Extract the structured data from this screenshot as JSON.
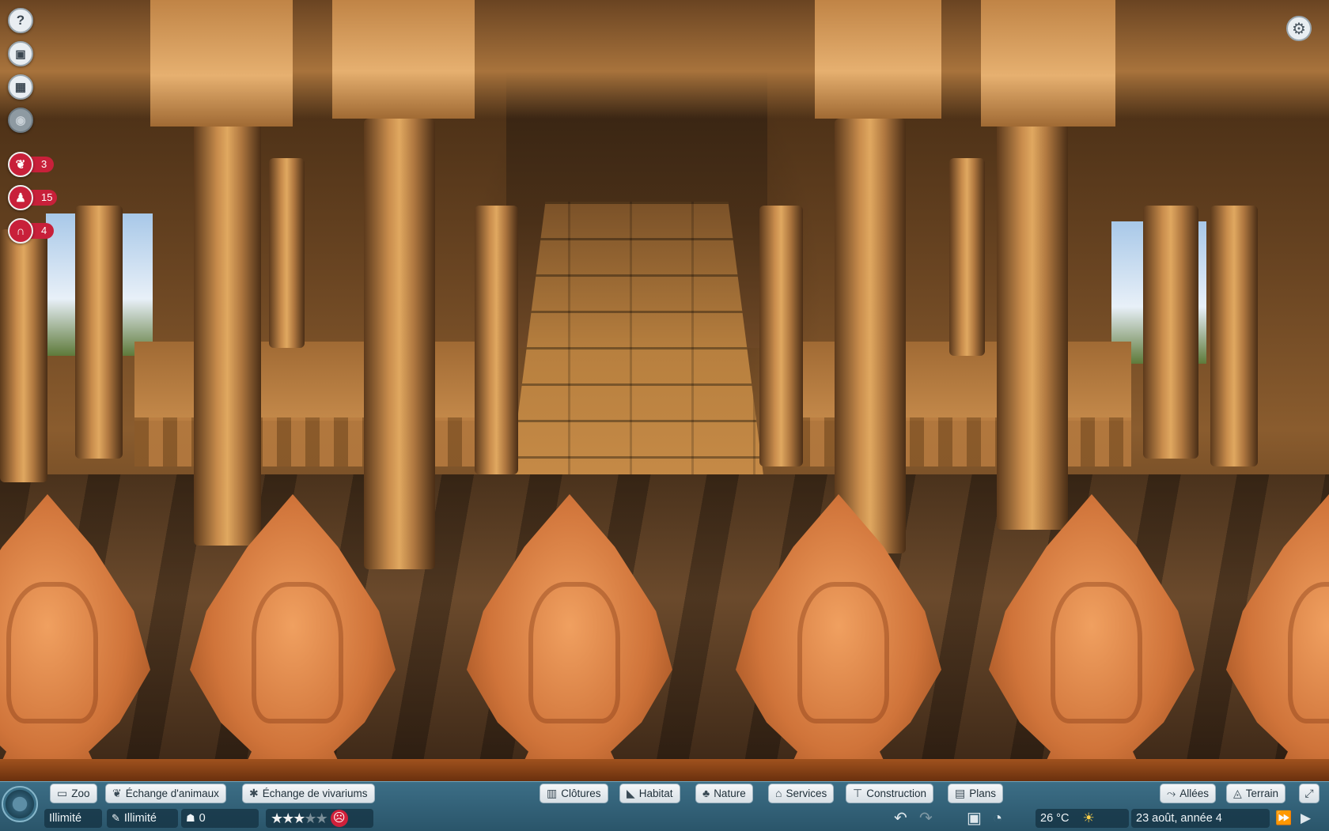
{
  "hud_left": {
    "help": {
      "label": "?"
    },
    "counters": [
      {
        "icon": "paw-icon",
        "count": "3"
      },
      {
        "icon": "guest-icon",
        "count": "15"
      },
      {
        "icon": "staff-icon",
        "count": "4"
      }
    ]
  },
  "toolbar": {
    "left_buttons": [
      {
        "icon": "tv-icon",
        "label": "Zoo"
      },
      {
        "icon": "paw-icon",
        "label": "Échange d'animaux"
      },
      {
        "icon": "bug-icon",
        "label": "Échange de vivariums"
      }
    ],
    "center_buttons": [
      {
        "icon": "fence-icon",
        "label": "Clôtures"
      },
      {
        "icon": "habitat-icon",
        "label": "Habitat"
      },
      {
        "icon": "tree-icon",
        "label": "Nature"
      },
      {
        "icon": "services-icon",
        "label": "Services"
      },
      {
        "icon": "construction-icon",
        "label": "Construction"
      },
      {
        "icon": "blueprint-icon",
        "label": "Plans"
      }
    ],
    "right_buttons": [
      {
        "icon": "path-icon",
        "label": "Allées"
      },
      {
        "icon": "terrain-icon",
        "label": "Terrain"
      }
    ]
  },
  "status": {
    "money": "Illimité",
    "research": "Illimité",
    "guests": "0",
    "rating": 3,
    "rating_max": 5,
    "temperature": "26 °C",
    "date": "23 août, année 4"
  },
  "colors": {
    "toolbar": "#2f5d73",
    "alert": "#c8203a"
  }
}
